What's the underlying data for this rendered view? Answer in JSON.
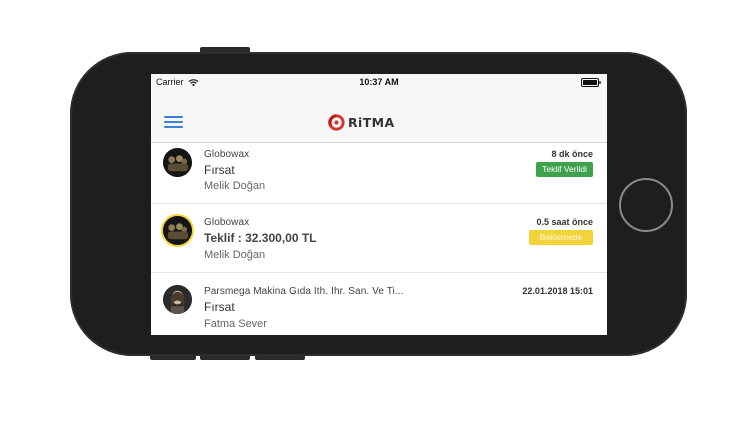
{
  "status_bar": {
    "carrier": "Carrier",
    "time": "10:37 AM",
    "wifi_icon": "wifi-icon",
    "battery_icon": "battery-icon"
  },
  "nav": {
    "menu_icon": "hamburger-menu-icon",
    "logo_text": "RiTMA",
    "logo_color": "#d9342b"
  },
  "items": [
    {
      "company": "Globowax",
      "title": "Fırsat",
      "person": "Melik Doğan",
      "time": "8 dk önce",
      "badge": "Teklif Verildi",
      "badge_color": "#3fa14c"
    },
    {
      "company": "Globowax",
      "title": "Teklif : 32.300,00 TL",
      "person": "Melik Doğan",
      "time": "0.5 saat önce",
      "badge": "Beklemede",
      "badge_color": "#f3d33a"
    },
    {
      "company": "Parsmega Makina Gıda İth. İhr. San. Ve Ti...",
      "title": "Fırsat",
      "person": "Fatma Sever",
      "time": "22.01.2018 15:01",
      "badge": ""
    }
  ]
}
